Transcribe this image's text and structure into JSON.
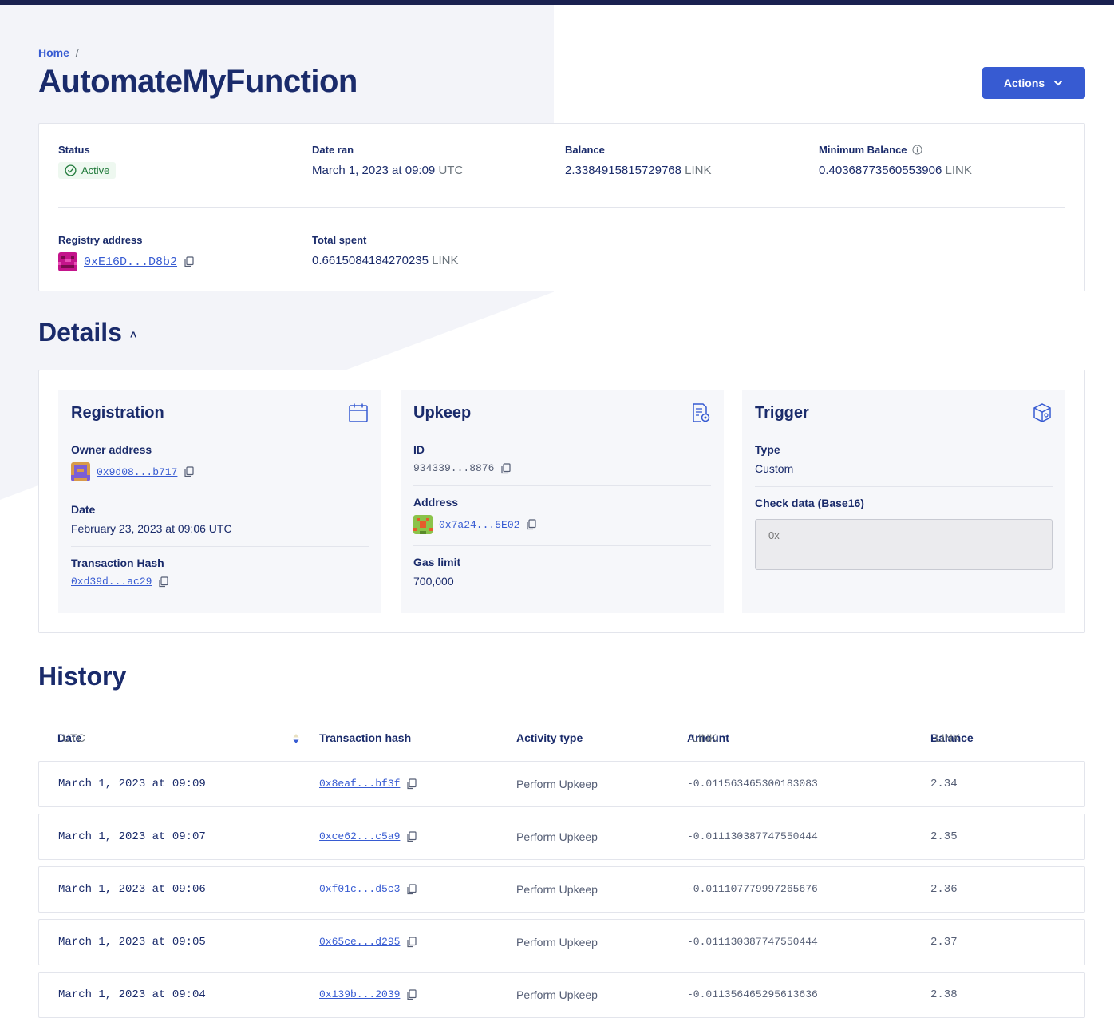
{
  "breadcrumb": {
    "home": "Home",
    "separator": "/"
  },
  "page_title": "AutomateMyFunction",
  "actions_label": "Actions",
  "summary": {
    "status": {
      "label": "Status",
      "value": "Active"
    },
    "date_ran": {
      "label": "Date ran",
      "value": "March 1, 2023 at 09:09",
      "unit": "UTC"
    },
    "balance": {
      "label": "Balance",
      "value": "2.3384915815729768",
      "unit": "LINK"
    },
    "minimum_balance": {
      "label": "Minimum Balance",
      "value": "0.40368773560553906",
      "unit": "LINK"
    },
    "registry_address": {
      "label": "Registry address",
      "value": "0xE16D...D8b2"
    },
    "total_spent": {
      "label": "Total spent",
      "value": "0.6615084184270235",
      "unit": "LINK"
    }
  },
  "details": {
    "title": "Details",
    "registration": {
      "title": "Registration",
      "owner_label": "Owner address",
      "owner_value": "0x9d08...b717",
      "date_label": "Date",
      "date_value": "February 23, 2023 at 09:06 UTC",
      "tx_label": "Transaction Hash",
      "tx_value": "0xd39d...ac29"
    },
    "upkeep": {
      "title": "Upkeep",
      "id_label": "ID",
      "id_value": "934339...8876",
      "address_label": "Address",
      "address_value": "0x7a24...5E02",
      "gas_label": "Gas limit",
      "gas_value": "700,000"
    },
    "trigger": {
      "title": "Trigger",
      "type_label": "Type",
      "type_value": "Custom",
      "check_label": "Check data (Base16)",
      "check_placeholder": "0x"
    }
  },
  "history": {
    "title": "History",
    "columns": {
      "date": "Date",
      "date_unit": "UTC",
      "hash": "Transaction hash",
      "activity": "Activity type",
      "amount": "Amount",
      "amount_unit": "LINK",
      "balance": "Balance",
      "balance_unit": "LINK"
    },
    "rows": [
      {
        "date": "March 1, 2023 at 09:09",
        "hash": "0x8eaf...bf3f",
        "activity": "Perform Upkeep",
        "amount": "-0.011563465300183083",
        "balance": "2.34"
      },
      {
        "date": "March 1, 2023 at 09:07",
        "hash": "0xce62...c5a9",
        "activity": "Perform Upkeep",
        "amount": "-0.011130387747550444",
        "balance": "2.35"
      },
      {
        "date": "March 1, 2023 at 09:06",
        "hash": "0xf01c...d5c3",
        "activity": "Perform Upkeep",
        "amount": "-0.011107779997265676",
        "balance": "2.36"
      },
      {
        "date": "March 1, 2023 at 09:05",
        "hash": "0x65ce...d295",
        "activity": "Perform Upkeep",
        "amount": "-0.011130387747550444",
        "balance": "2.37"
      },
      {
        "date": "March 1, 2023 at 09:04",
        "hash": "0x139b...2039",
        "activity": "Perform Upkeep",
        "amount": "-0.011356465295613636",
        "balance": "2.38"
      }
    ]
  },
  "colors": {
    "accent": "#375bd2",
    "title": "#1a2b6b",
    "topbar": "#1a2150",
    "status_green": "#217a3b"
  },
  "icons": [
    "check-circle-icon",
    "info-icon",
    "copy-icon",
    "chevron-down-icon",
    "calendar-icon",
    "document-gear-icon",
    "cube-icon",
    "sort-icon"
  ]
}
